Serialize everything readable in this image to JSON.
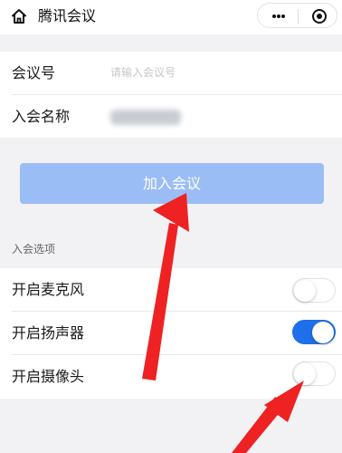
{
  "header": {
    "title": "腾讯会议",
    "home_icon": "home-icon",
    "more_icon": "more-dots-icon",
    "close_icon": "target-icon"
  },
  "form": {
    "meeting_id_label": "会议号",
    "meeting_id_placeholder": "请输入会议号",
    "meeting_id_value": "",
    "display_name_label": "入会名称"
  },
  "join_button_label": "加入会议",
  "options": {
    "section_title": "入会选项",
    "items": [
      {
        "label": "开启麦克风",
        "enabled": false
      },
      {
        "label": "开启扬声器",
        "enabled": true
      },
      {
        "label": "开启摄像头",
        "enabled": false
      }
    ]
  },
  "colors": {
    "accent": "#1e6fe9",
    "join_button": "#9bbdf6",
    "annotation_arrow": "#ee2222",
    "background": "#f2f2f4"
  }
}
